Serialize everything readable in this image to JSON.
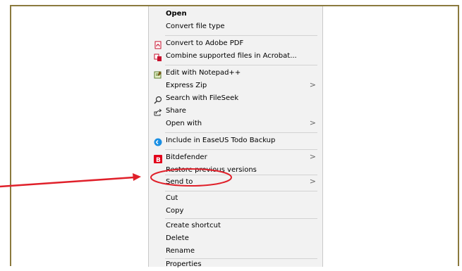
{
  "context_menu": {
    "items": [
      {
        "label": "Open",
        "bold": true
      },
      {
        "label": "Convert file type"
      },
      {
        "label": "Convert to Adobe PDF",
        "icon": "adobe-pdf-icon"
      },
      {
        "label": "Combine supported files in Acrobat...",
        "icon": "acrobat-combine-icon"
      },
      {
        "label": "Edit with Notepad++",
        "icon": "notepad-plus-plus-icon"
      },
      {
        "label": "Express Zip",
        "has_submenu": true
      },
      {
        "label": "Search with FileSeek",
        "icon": "search-icon"
      },
      {
        "label": "Share",
        "icon": "share-icon"
      },
      {
        "label": "Open with",
        "has_submenu": true
      },
      {
        "label": "Include in EaseUS Todo Backup",
        "icon": "easeus-backup-icon"
      },
      {
        "label": "Bitdefender",
        "icon": "bitdefender-icon",
        "has_submenu": true
      },
      {
        "label": "Restore previous versions"
      },
      {
        "label": "Send to",
        "has_submenu": true,
        "highlighted": true
      },
      {
        "label": "Cut"
      },
      {
        "label": "Copy"
      },
      {
        "label": "Create shortcut"
      },
      {
        "label": "Delete"
      },
      {
        "label": "Rename"
      },
      {
        "label": "Properties"
      }
    ],
    "submenu_glyph": ">"
  },
  "annotation": {
    "highlight_color": "#e0202a",
    "target_item": "Send to"
  },
  "colors": {
    "frame_border": "#8b7a3e",
    "menu_background": "#f2f2f2",
    "separator": "#d2d2d2"
  }
}
